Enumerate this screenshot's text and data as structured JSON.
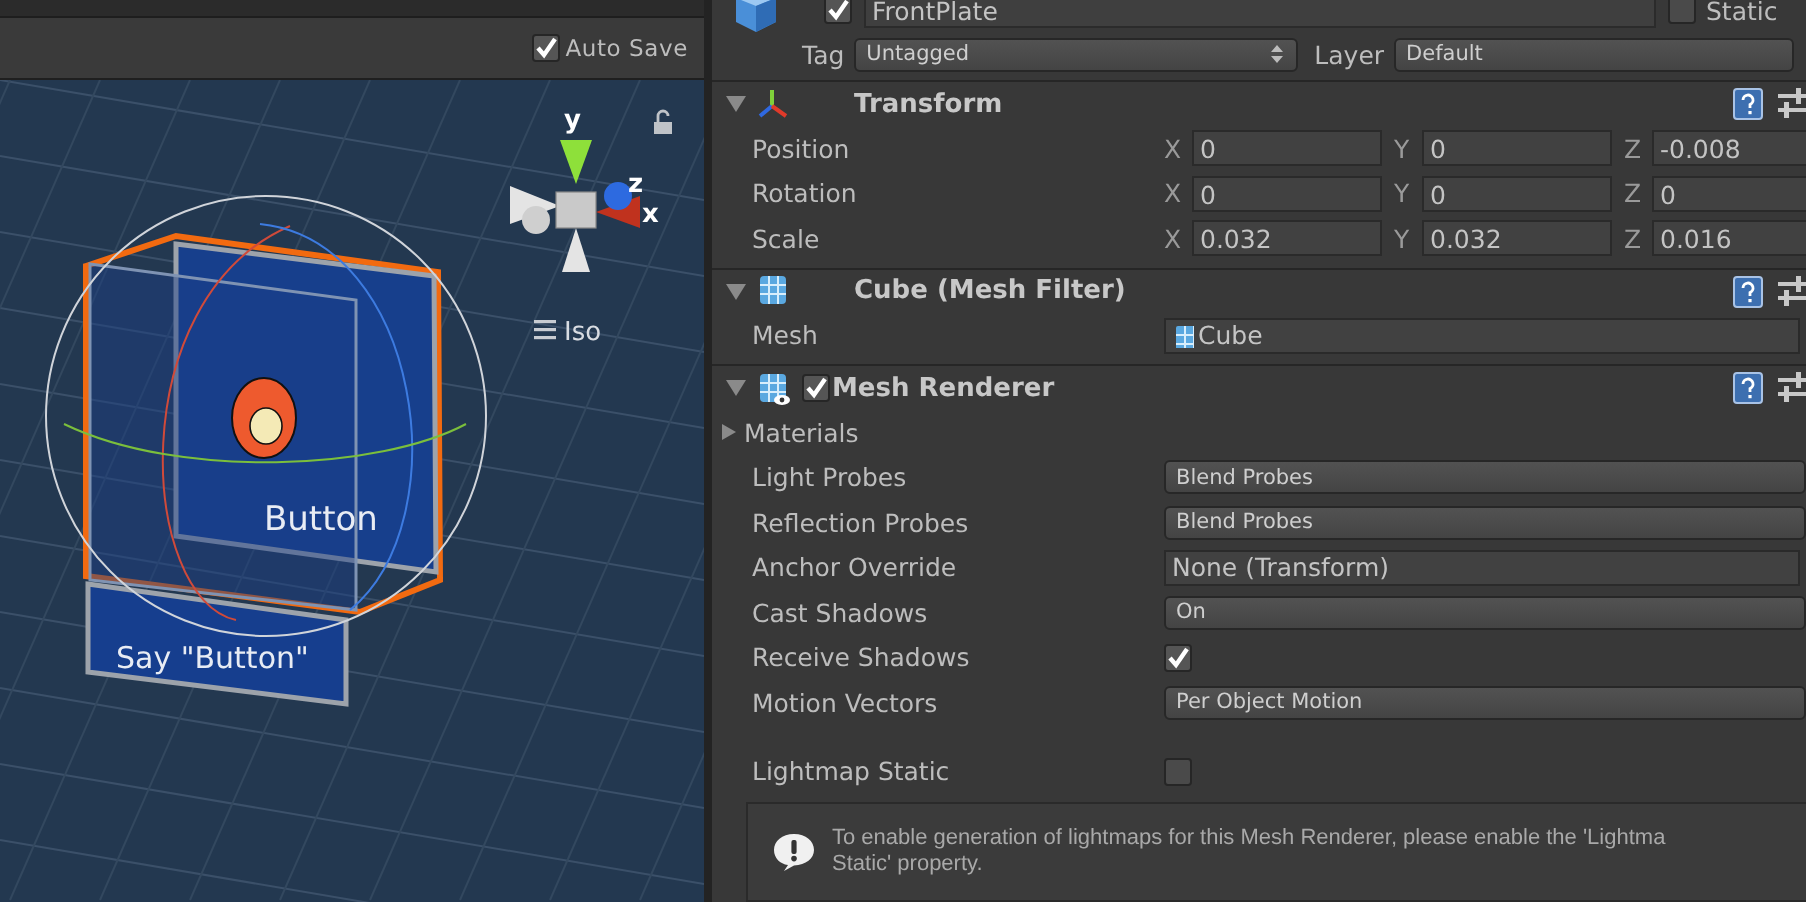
{
  "scene_view": {
    "auto_save": {
      "label": "Auto Save",
      "checked": true
    },
    "gizmo_axes": [
      {
        "axis": "y"
      },
      {
        "axis": "z"
      },
      {
        "axis": "x"
      }
    ],
    "projection": "Iso",
    "plates": [
      {
        "label": "Button"
      },
      {
        "label": "Say \"Button\""
      }
    ]
  },
  "inspector": {
    "object": {
      "active": true,
      "name": "FrontPlate",
      "static": {
        "label": "Static",
        "checked": false
      }
    },
    "tag": {
      "label": "Tag",
      "value": "Untagged"
    },
    "layer": {
      "label": "Layer",
      "value": "Default"
    },
    "components": [
      {
        "kind": "transform",
        "title": "Transform",
        "expanded": true,
        "rows": [
          {
            "label": "Position",
            "axes": [
              {
                "axis": "X",
                "value": "0"
              },
              {
                "axis": "Y",
                "value": "0"
              },
              {
                "axis": "Z",
                "value": "-0.008"
              }
            ]
          },
          {
            "label": "Rotation",
            "axes": [
              {
                "axis": "X",
                "value": "0"
              },
              {
                "axis": "Y",
                "value": "0"
              },
              {
                "axis": "Z",
                "value": "0"
              }
            ]
          },
          {
            "label": "Scale",
            "axes": [
              {
                "axis": "X",
                "value": "0.032"
              },
              {
                "axis": "Y",
                "value": "0.032"
              },
              {
                "axis": "Z",
                "value": "0.016"
              }
            ]
          }
        ]
      },
      {
        "kind": "mesh_filter",
        "title": "Cube (Mesh Filter)",
        "expanded": true,
        "properties": [
          {
            "kind": "object",
            "label": "Mesh",
            "value": "Cube",
            "icon": true
          }
        ]
      },
      {
        "kind": "mesh_renderer",
        "title": "Mesh Renderer",
        "enabled": true,
        "expanded": true,
        "properties": [
          {
            "kind": "foldout",
            "label": "Materials",
            "expanded": false
          },
          {
            "kind": "dropdown",
            "label": "Light Probes",
            "value": "Blend Probes"
          },
          {
            "kind": "dropdown",
            "label": "Reflection Probes",
            "value": "Blend Probes"
          },
          {
            "kind": "object",
            "label": "Anchor Override",
            "value": "None (Transform)",
            "icon": false
          },
          {
            "kind": "dropdown",
            "label": "Cast Shadows",
            "value": "On"
          },
          {
            "kind": "toggle",
            "label": "Receive Shadows",
            "checked": true
          },
          {
            "kind": "dropdown",
            "label": "Motion Vectors",
            "value": "Per Object Motion"
          },
          {
            "kind": "spacer"
          },
          {
            "kind": "toggle",
            "label": "Lightmap Static",
            "checked": false
          },
          {
            "kind": "help",
            "lines": [
              "To enable generation of lightmaps for this Mesh Renderer, please enable the 'Lightma",
              "Static' property."
            ]
          }
        ]
      }
    ]
  }
}
